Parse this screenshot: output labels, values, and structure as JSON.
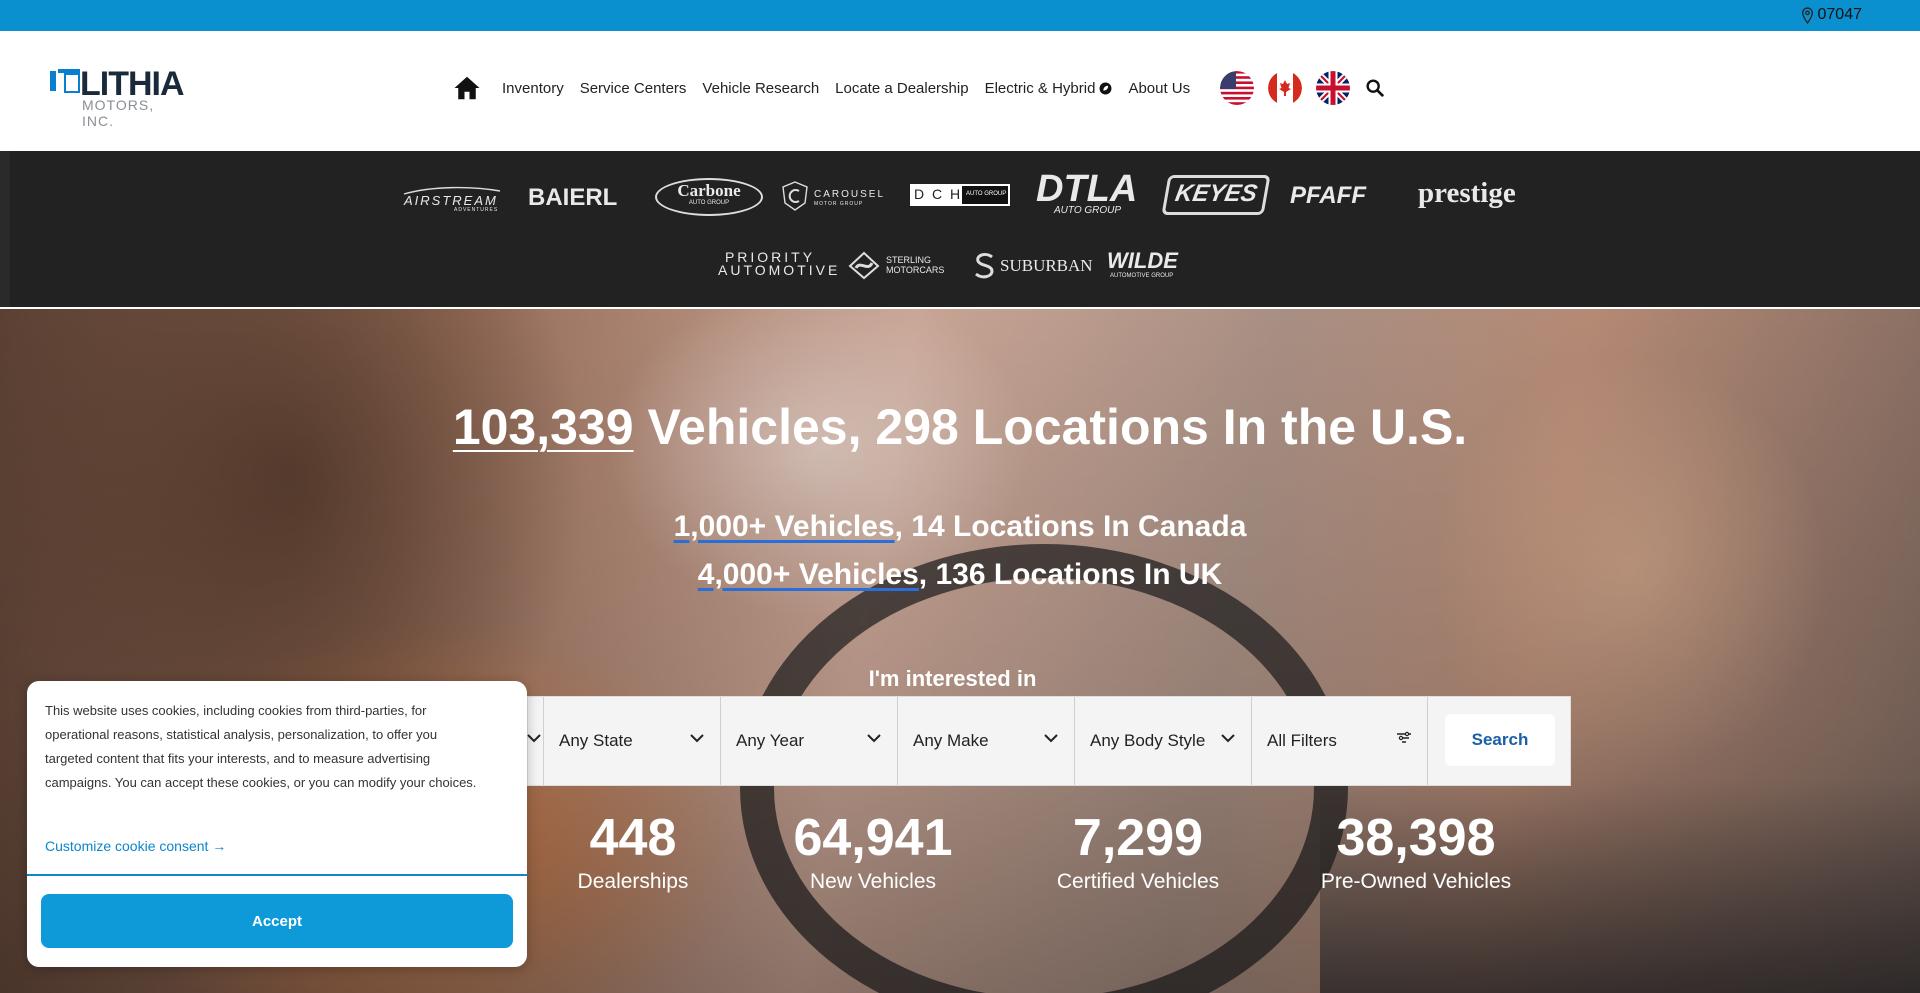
{
  "topbar": {
    "zip": "07047",
    "icon": "location-pin-icon"
  },
  "logo": {
    "word": "LITHIA",
    "sub": "MOTORS, INC."
  },
  "nav": {
    "items": [
      {
        "label": "Inventory"
      },
      {
        "label": "Service Centers"
      },
      {
        "label": "Vehicle Research"
      },
      {
        "label": "Locate a Dealership"
      },
      {
        "label": "Electric & Hybrid"
      },
      {
        "label": "About Us"
      }
    ]
  },
  "brands": [
    {
      "name": "AIRSTREAM"
    },
    {
      "name": "BAIERL"
    },
    {
      "name": "Carbone"
    },
    {
      "name": "CAROUSEL"
    },
    {
      "name": "D C H"
    },
    {
      "name": "DTLA"
    },
    {
      "name": "KEYES"
    },
    {
      "name": "PFAFF"
    },
    {
      "name": "prestige"
    },
    {
      "name": "PRIORITY AUTOMOTIVE"
    },
    {
      "name": "STERLING MOTORCARS"
    },
    {
      "name": "SUBURBAN"
    },
    {
      "name": "WILDE"
    }
  ],
  "brand_subtitles": {
    "airstream": "ADVENTURES",
    "carbone": "AUTO GROUP",
    "carousel": "MOTOR GROUP",
    "dch": "AUTO GROUP",
    "dtla": "AUTO GROUP",
    "wilde": "AUTOMOTIVE GROUP"
  },
  "hero": {
    "us_count": "103,339",
    "us_rest": " Vehicles, 298 Locations In the U.S.",
    "canada_link": "1,000+ Vehicles",
    "canada_rest": ", 14 Locations In Canada",
    "uk_link": "4,000+ Vehicles",
    "uk_rest": ", 136 Locations In UK",
    "interested": "I'm interested in"
  },
  "filters": {
    "state": "Any State",
    "year": "Any Year",
    "make": "Any Make",
    "body": "Any Body Style",
    "all": "All Filters",
    "search": "Search"
  },
  "stats": [
    {
      "num": "448",
      "label": "Dealerships"
    },
    {
      "num": "64,941",
      "label": "New Vehicles"
    },
    {
      "num": "7,299",
      "label": "Certified Vehicles"
    },
    {
      "num": "38,398",
      "label": "Pre-Owned Vehicles"
    }
  ],
  "cookie": {
    "text": "This website uses cookies, including cookies from third-parties, for operational reasons, statistical analysis, personalization, to offer you targeted content that fits your interests, and to measure advertising campaigns. You can accept these cookies, or you can modify your choices.",
    "customize": "Customize cookie consent →",
    "accept": "Accept"
  },
  "colors": {
    "topbar": "#0a90cf",
    "brandbar": "#222222",
    "accent": "#0e9ad8",
    "search_text": "#1a5fa8"
  }
}
